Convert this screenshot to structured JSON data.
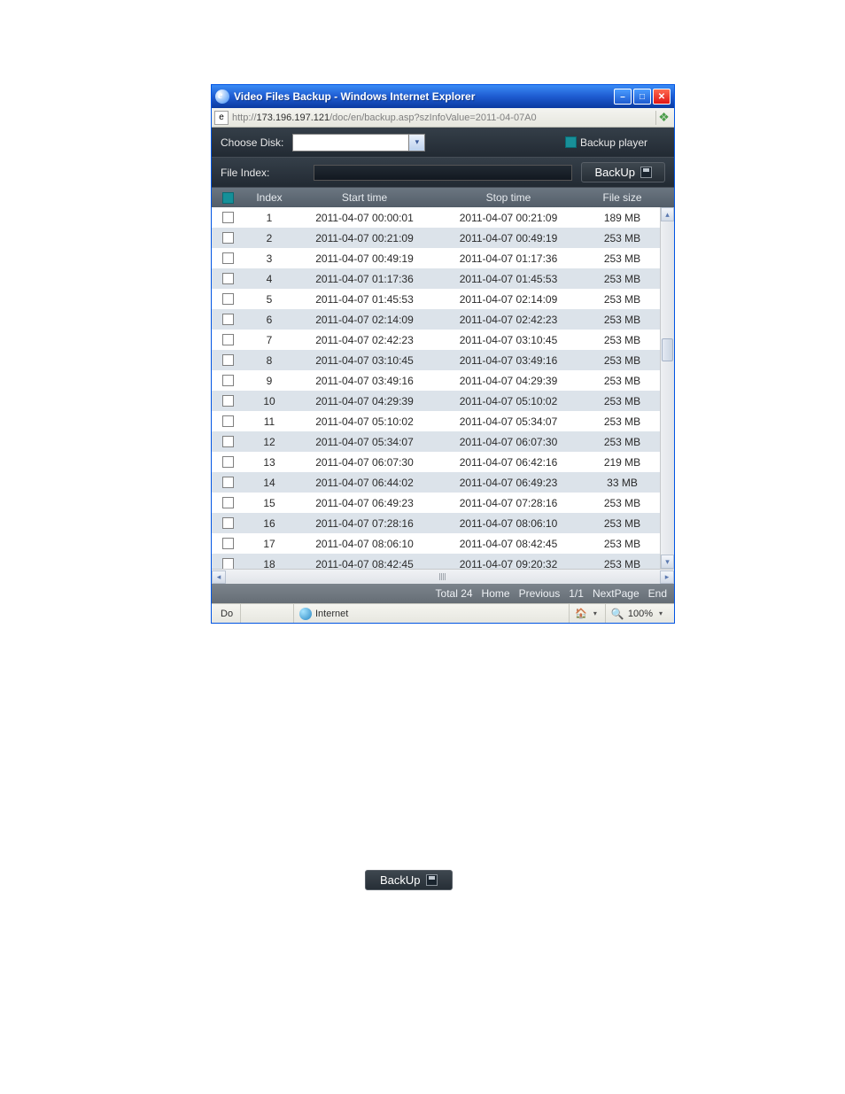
{
  "window": {
    "title": "Video Files Backup - Windows Internet Explorer",
    "url_prefix": "http://",
    "url_host": "173.196.197.121",
    "url_path": "/doc/en/backup.asp?szInfoValue=2011-04-07A0"
  },
  "toolbar": {
    "choose_disk_label": "Choose Disk:",
    "backup_player_label": "Backup player",
    "file_index_label": "File Index:",
    "backup_button": "BackUp"
  },
  "columns": {
    "index": "Index",
    "start": "Start time",
    "stop": "Stop time",
    "size": "File size"
  },
  "rows": [
    {
      "idx": "1",
      "start": "2011-04-07 00:00:01",
      "stop": "2011-04-07 00:21:09",
      "size": "189 MB"
    },
    {
      "idx": "2",
      "start": "2011-04-07 00:21:09",
      "stop": "2011-04-07 00:49:19",
      "size": "253 MB"
    },
    {
      "idx": "3",
      "start": "2011-04-07 00:49:19",
      "stop": "2011-04-07 01:17:36",
      "size": "253 MB"
    },
    {
      "idx": "4",
      "start": "2011-04-07 01:17:36",
      "stop": "2011-04-07 01:45:53",
      "size": "253 MB"
    },
    {
      "idx": "5",
      "start": "2011-04-07 01:45:53",
      "stop": "2011-04-07 02:14:09",
      "size": "253 MB"
    },
    {
      "idx": "6",
      "start": "2011-04-07 02:14:09",
      "stop": "2011-04-07 02:42:23",
      "size": "253 MB"
    },
    {
      "idx": "7",
      "start": "2011-04-07 02:42:23",
      "stop": "2011-04-07 03:10:45",
      "size": "253 MB"
    },
    {
      "idx": "8",
      "start": "2011-04-07 03:10:45",
      "stop": "2011-04-07 03:49:16",
      "size": "253 MB"
    },
    {
      "idx": "9",
      "start": "2011-04-07 03:49:16",
      "stop": "2011-04-07 04:29:39",
      "size": "253 MB"
    },
    {
      "idx": "10",
      "start": "2011-04-07 04:29:39",
      "stop": "2011-04-07 05:10:02",
      "size": "253 MB"
    },
    {
      "idx": "11",
      "start": "2011-04-07 05:10:02",
      "stop": "2011-04-07 05:34:07",
      "size": "253 MB"
    },
    {
      "idx": "12",
      "start": "2011-04-07 05:34:07",
      "stop": "2011-04-07 06:07:30",
      "size": "253 MB"
    },
    {
      "idx": "13",
      "start": "2011-04-07 06:07:30",
      "stop": "2011-04-07 06:42:16",
      "size": "219 MB"
    },
    {
      "idx": "14",
      "start": "2011-04-07 06:44:02",
      "stop": "2011-04-07 06:49:23",
      "size": "33 MB"
    },
    {
      "idx": "15",
      "start": "2011-04-07 06:49:23",
      "stop": "2011-04-07 07:28:16",
      "size": "253 MB"
    },
    {
      "idx": "16",
      "start": "2011-04-07 07:28:16",
      "stop": "2011-04-07 08:06:10",
      "size": "253 MB"
    },
    {
      "idx": "17",
      "start": "2011-04-07 08:06:10",
      "stop": "2011-04-07 08:42:45",
      "size": "253 MB"
    },
    {
      "idx": "18",
      "start": "2011-04-07 08:42:45",
      "stop": "2011-04-07 09:20:32",
      "size": "253 MB"
    }
  ],
  "pager": {
    "total": "Total 24",
    "home": "Home",
    "previous": "Previous",
    "page": "1/1",
    "next": "NextPage",
    "end": "End"
  },
  "status": {
    "done": "Do",
    "zone": "Internet",
    "zoom": "100%"
  },
  "separate_button": {
    "label": "BackUp"
  }
}
